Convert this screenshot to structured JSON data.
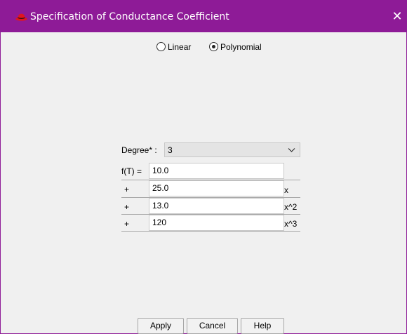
{
  "window": {
    "title": "Specification of Conductance Coefficient",
    "close_glyph": "✕",
    "accent_color": "#8e1b97",
    "icon": "red-hat-icon"
  },
  "mode": {
    "options": [
      "Linear",
      "Polynomial"
    ],
    "selected": "Polynomial"
  },
  "degree": {
    "label": "Degree* :",
    "value": "3"
  },
  "terms": [
    {
      "prefix": "f(T) =",
      "value": "10.0",
      "suffix": ""
    },
    {
      "prefix": "+",
      "value": "25.0",
      "suffix": "x"
    },
    {
      "prefix": "+",
      "value": "13.0",
      "suffix": "x^2"
    },
    {
      "prefix": "+",
      "value": "120",
      "suffix": "x^3"
    }
  ],
  "buttons": {
    "apply": "Apply",
    "cancel": "Cancel",
    "help": "Help"
  }
}
